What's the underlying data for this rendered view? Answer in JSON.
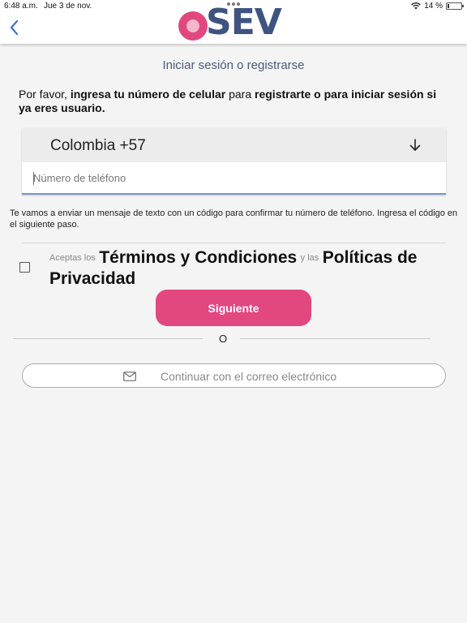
{
  "status_bar": {
    "time": "6:48 a.m.",
    "date": "Jue 3 de nov.",
    "battery_text": "14 %",
    "battery_level": 0.14
  },
  "header": {
    "logo_text": "SEV",
    "brand_color": "#e2477f",
    "logo_text_color": "#3e5480"
  },
  "page_title": "Iniciar sesión o registrarse",
  "intro": {
    "part1": "Por favor, ",
    "part2": "ingresa tu número de celular",
    "part3": " para ",
    "part4": "registrarte o para iniciar sesión si ya eres usuario."
  },
  "phone": {
    "country_label": "Colombia +57",
    "placeholder": "Número de teléfono",
    "value": ""
  },
  "info_text": "Te vamos a enviar un mensaje de texto con un código para confirmar tu número de teléfono. Ingresa el código en el siguiente paso.",
  "terms": {
    "prefix": "Aceptas los",
    "terms_link": "Términos y Condiciones",
    "connector": "y las",
    "privacy_link": "Políticas de Privacidad",
    "checked": false
  },
  "next_button": "Siguiente",
  "or_text": "O",
  "email_button": "Continuar con el correo electrónico"
}
